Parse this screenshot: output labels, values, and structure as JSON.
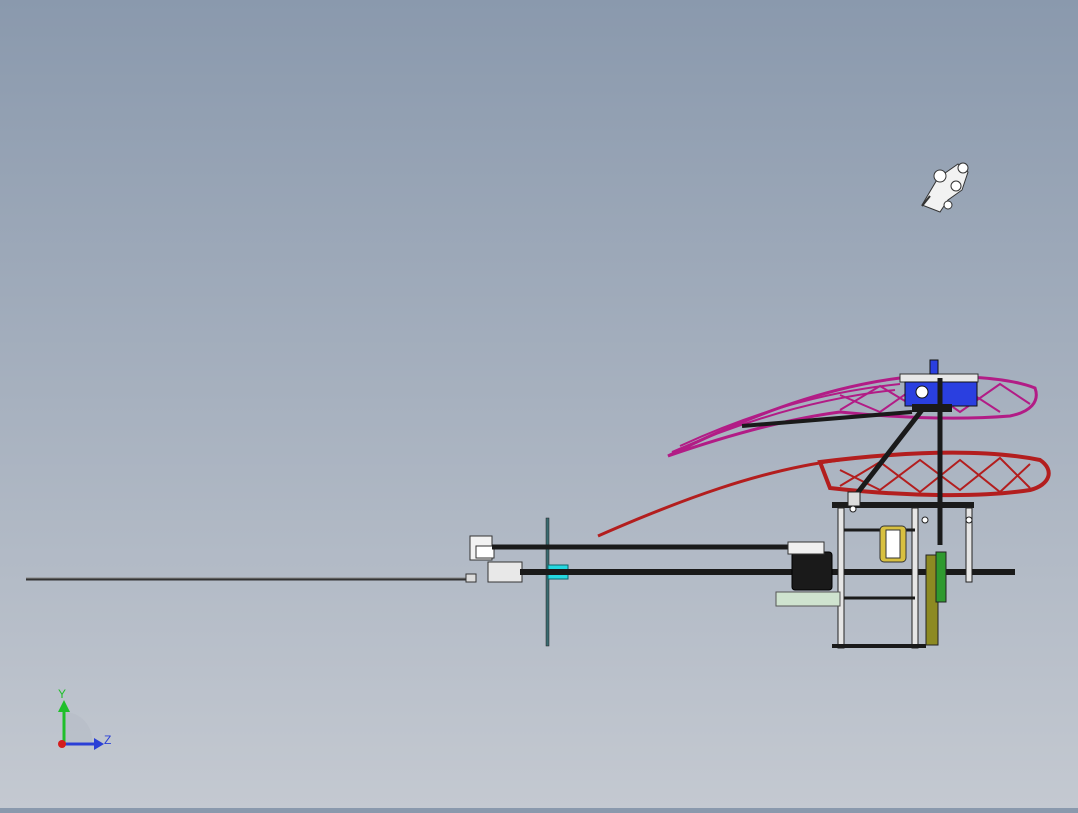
{
  "triad": {
    "y_label": "Y",
    "z_label": "Z",
    "y_color": "#1fbf2a",
    "z_color": "#2a3fd6",
    "x_color": "#d41e1e"
  },
  "colors": {
    "background_top": "#8a99ad",
    "background_bottom": "#c4c9d1",
    "main_blade": "#b21c86",
    "tail_blade": "#b31e1e",
    "frame": "#1a1a1a",
    "servo_blue": "#2a3fe0",
    "cyan_part": "#25d8e0",
    "gear_olive": "#8d8a22",
    "motor_yellow": "#d8c040",
    "green_part": "#2f9a2f",
    "tray": "#cfe3cf"
  },
  "model": {
    "name_icon": "helicopter-assembly-icon"
  }
}
